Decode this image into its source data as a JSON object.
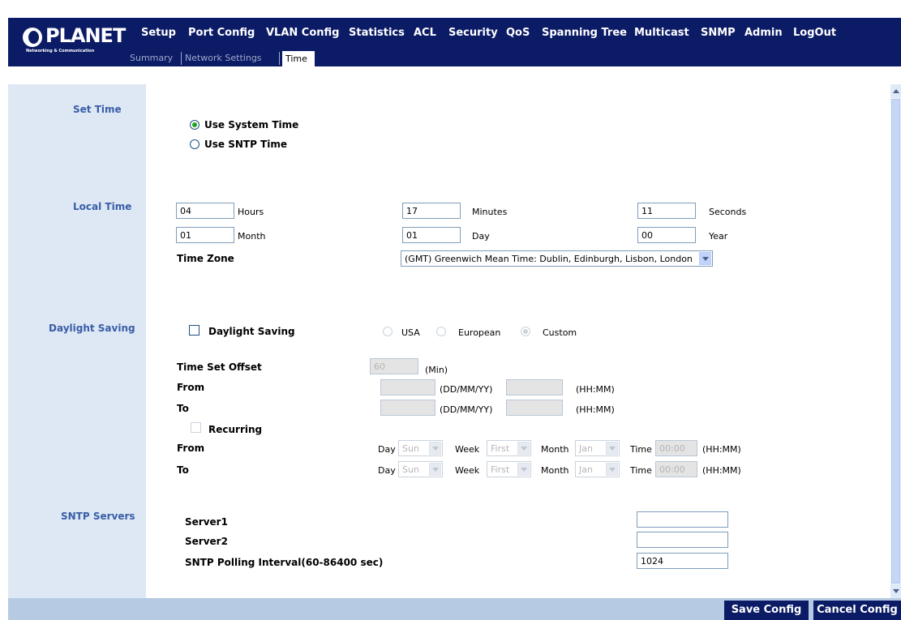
{
  "brand": {
    "name": "PLANET",
    "tagline": "Networking & Communication"
  },
  "nav": {
    "items": [
      "Setup",
      "Port Config",
      "VLAN Config",
      "Statistics",
      "ACL",
      "Security",
      "QoS",
      "Spanning Tree",
      "Multicast",
      "SNMP",
      "Admin",
      "LogOut"
    ],
    "active": "Setup"
  },
  "subnav": {
    "items": [
      "Summary",
      "Network Settings",
      "Time"
    ],
    "active": "Time"
  },
  "sections": {
    "set_time": "Set Time",
    "local_time": "Local Time",
    "daylight_saving": "Daylight Saving",
    "sntp_servers": "SNTP Servers"
  },
  "set_time": {
    "use_system_time": "Use System Time",
    "use_sntp_time": "Use SNTP Time",
    "selected": "Use System Time"
  },
  "local_time": {
    "hours_value": "04",
    "hours_label": "Hours",
    "minutes_value": "17",
    "minutes_label": "Minutes",
    "seconds_value": "11",
    "seconds_label": "Seconds",
    "month_value": "01",
    "month_label": "Month",
    "day_value": "01",
    "day_label": "Day",
    "year_value": "00",
    "year_label": "Year",
    "timezone_label": "Time Zone",
    "timezone_value": "(GMT) Greenwich Mean Time: Dublin, Edinburgh, Lisbon, London"
  },
  "daylight": {
    "checkbox_label": "Daylight Saving",
    "checked": false,
    "usa": "USA",
    "european": "European",
    "custom": "Custom",
    "selected_region": "Custom",
    "offset_label": "Time Set Offset",
    "offset_value": "60",
    "offset_unit": "(Min)",
    "from_label": "From",
    "to_label": "To",
    "date_format": "(DD/MM/YY)",
    "time_format": "(HH:MM)",
    "recurring_label": "Recurring",
    "recurring_checked": false,
    "day_label": "Day",
    "week_label": "Week",
    "month_label": "Month",
    "time_label": "Time",
    "from_day": "Sun",
    "from_week": "First",
    "from_month": "Jan",
    "from_time": "00:00",
    "to_day": "Sun",
    "to_week": "First",
    "to_month": "Jan",
    "to_time": "00:00"
  },
  "sntp": {
    "server1_label": "Server1",
    "server1_value": "",
    "server2_label": "Server2",
    "server2_value": "",
    "polling_label": "SNTP Polling Interval(60-86400 sec)",
    "polling_value": "1024"
  },
  "footer": {
    "save": "Save Config",
    "cancel": "Cancel Config"
  },
  "colors": {
    "header_bg": "#0b1b66",
    "sidebar_bg": "#dde8f4",
    "section_label": "#3a5da8",
    "footer_bg": "#b6cbe3"
  }
}
